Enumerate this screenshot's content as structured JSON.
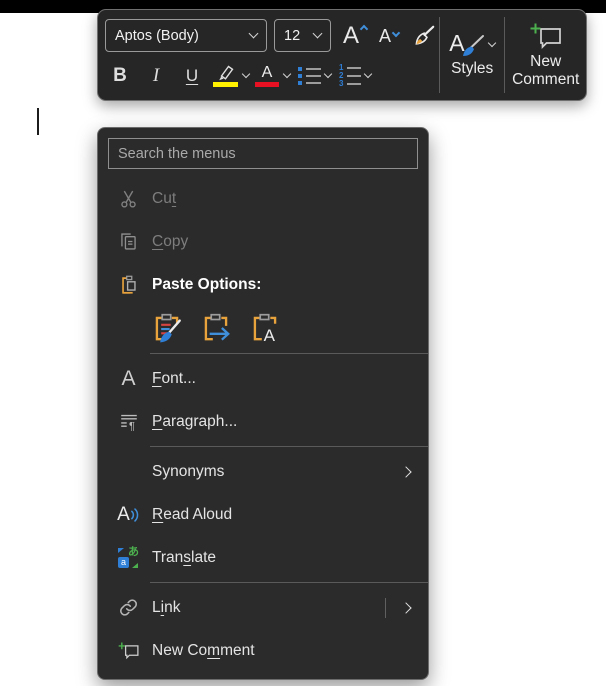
{
  "toolbar": {
    "font_name": "Aptos (Body)",
    "font_size": "12",
    "grow_font_letter": "A",
    "shrink_font_letter": "A",
    "bold_label": "B",
    "italic_label": "I",
    "underline_label": "U",
    "font_color_letter": "A",
    "styles_letter": "A",
    "styles_label": "Styles",
    "new_comment_label": "New Comment",
    "numbering_digits": [
      "1",
      "2",
      "3"
    ]
  },
  "menu": {
    "search_placeholder": "Search the menus",
    "cut": {
      "pre": "Cu",
      "key": "t",
      "post": ""
    },
    "copy": {
      "pre": "",
      "key": "C",
      "post": "opy"
    },
    "paste_options_label": "Paste Options:",
    "font": {
      "pre": "",
      "key": "F",
      "post": "ont..."
    },
    "paragraph": {
      "pre": "",
      "key": "P",
      "post": "aragraph..."
    },
    "synonyms_label": "Synonyms",
    "read_aloud": {
      "pre": "",
      "key": "R",
      "post": "ead Aloud"
    },
    "translate": {
      "pre": "Tran",
      "key": "s",
      "post": "late"
    },
    "link": {
      "pre": "L",
      "key": "i",
      "post": "nk"
    },
    "new_comment": {
      "pre": "New Co",
      "key": "m",
      "post": "ment"
    }
  },
  "icons": {
    "font_icon_letter": "A",
    "paragraph_mark": "¶",
    "read_aloud_letter": "A",
    "translate_latin": "a",
    "translate_kana": "あ",
    "paste_text_letter": "A"
  },
  "colors": {
    "accent_blue": "#2f7fd6",
    "green_plus": "#4db04f",
    "highlight_yellow": "#fff100",
    "font_color_red": "#e81123",
    "clipboard_orange": "#e8a33d",
    "toolbar_bg": "#262626",
    "menu_bg": "#2b2b2b"
  }
}
